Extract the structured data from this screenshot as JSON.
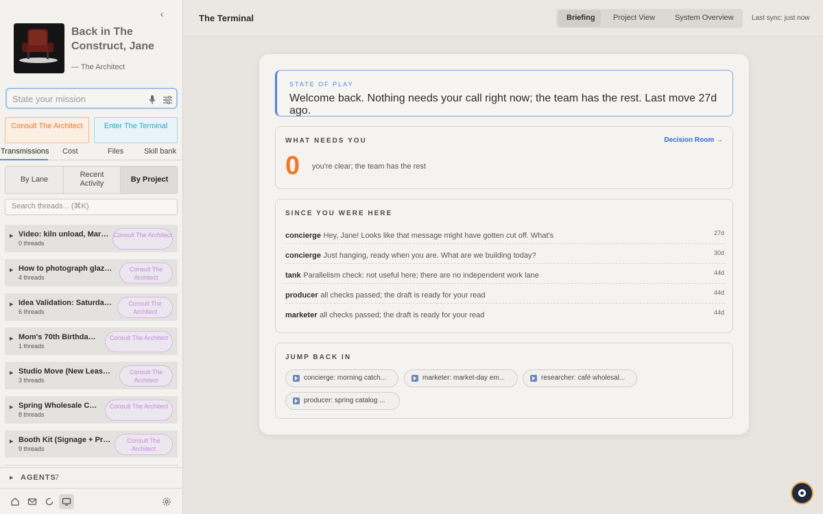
{
  "sidebar": {
    "collapse_glyph": "‹",
    "profile": {
      "title": "Back in The Construct, Jane",
      "subtitle": "— The Architect",
      "image_icon": "red-armchair-image"
    },
    "mission": {
      "placeholder": "State your mission",
      "mic_icon": "microphone-icon",
      "settings_icon": "sliders-icon"
    },
    "actions": {
      "consult": "Consult The Architect",
      "terminal": "Enter The Terminal"
    },
    "tabs": [
      "Transmissions",
      "Cost",
      "Files",
      "Skill bank"
    ],
    "segments": [
      "By Lane",
      "Recent Activity",
      "By Project"
    ],
    "search_placeholder": "Search threads... (⌘K)",
    "projects": [
      {
        "name": "Video: kiln unload, March...",
        "count": "0 threads",
        "button": "Consult The Architect"
      },
      {
        "name": "How to photograph glazes...",
        "count": "4 threads",
        "button": "Consult The Architect"
      },
      {
        "name": "Idea Validation: Saturday ...",
        "count": "6 threads",
        "button": "Consult The Architect"
      },
      {
        "name": "Mom's 70th Birthday ...",
        "count": "1 threads",
        "button": "Consult The Architect"
      },
      {
        "name": "Studio Move (New Lease ...",
        "count": "3 threads",
        "button": "Consult The Architect"
      },
      {
        "name": "Spring Wholesale Cat...",
        "count": "8 threads",
        "button": "Consult The Architect"
      },
      {
        "name": "Booth Kit (Signage + Pric...",
        "count": "9 threads",
        "button": "Consult The Architect"
      }
    ],
    "agents": {
      "label": "AGENTS",
      "count": "7"
    },
    "bottom_icons": [
      "home-icon",
      "inbox-icon",
      "refresh-icon",
      "monitor-icon",
      "gear-icon"
    ]
  },
  "topbar": {
    "title": "The Terminal",
    "views": [
      "Briefing",
      "Project View",
      "System Overview"
    ],
    "sync": "Last sync: just now"
  },
  "briefing": {
    "state_of_play": {
      "label": "STATE OF PLAY",
      "message": "Welcome back. Nothing needs your call right now; the team has the rest. Last move 27d ago."
    },
    "needs_you": {
      "label": "WHAT NEEDS YOU",
      "link": "Decision Room →",
      "count": "0",
      "note": "you're clear; the team has the rest"
    },
    "since": {
      "label": "SINCE YOU WERE HERE",
      "items": [
        {
          "who": "concierge",
          "what": "Hey, Jane! Looks like that message might have gotten cut off. What's",
          "ago": "27d"
        },
        {
          "who": "concierge",
          "what": "Just hanging, ready when you are. What are we building today?",
          "ago": "30d"
        },
        {
          "who": "tank",
          "what": "Parallelism check: not useful here; there are no independent work lane",
          "ago": "44d"
        },
        {
          "who": "producer",
          "what": "all checks passed; the draft is ready for your read",
          "ago": "44d"
        },
        {
          "who": "marketer",
          "what": "all checks passed; the draft is ready for your read",
          "ago": "44d"
        }
      ]
    },
    "jump": {
      "label": "JUMP BACK IN",
      "chips": [
        "concierge: morning catch...",
        "marketer: market-day em...",
        "researcher: café wholesal...",
        "producer: spring catalog ..."
      ]
    }
  },
  "colors": {
    "accent_blue": "#4c82d8",
    "orange": "#ec7a2a",
    "cyan": "#2aa9c8",
    "purple": "#c48ae0"
  },
  "fab_icon": "assistant-orb-icon"
}
